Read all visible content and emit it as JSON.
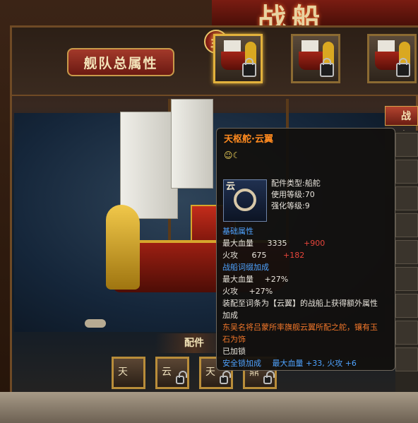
{
  "header": {
    "banner_title": "战船"
  },
  "fleet": {
    "attributes_button": "舰队总属性",
    "main_badge": "主",
    "ships": [
      {
        "state": "active"
      },
      {
        "state": "locked"
      },
      {
        "state": "locked"
      }
    ]
  },
  "right_panel": {
    "tab_label": "战船"
  },
  "parts": {
    "label": "配件",
    "slots": [
      {
        "glyph": "天"
      },
      {
        "glyph": "云"
      },
      {
        "glyph": "天"
      },
      {
        "glyph": "鼎"
      }
    ]
  },
  "tooltip": {
    "title": "天枢舵·云翼",
    "emotes": "☺☾",
    "icon_glyph": "云",
    "part_type_label": "配件类型:",
    "part_type_value": "船舵",
    "use_level_label": "使用等级:",
    "use_level_value": "70",
    "enhance_level_label": "强化等级:",
    "enhance_level_value": "9",
    "base_attr_title": "基础属性",
    "base_attrs": [
      {
        "name": "最大血量",
        "value": "3335",
        "bonus": "+900"
      },
      {
        "name": "火攻",
        "value": "675",
        "bonus": "+182"
      }
    ],
    "affix_title": "战船词缀加成",
    "affixes": [
      {
        "name": "最大血量",
        "value": "+27%"
      },
      {
        "name": "火攻",
        "value": "+27%"
      }
    ],
    "desc_line1": "装配至词条为【云翼】的战船上获得额外属性",
    "desc_line2": "加成",
    "lore_line1": "东吴名将吕蒙所率旗舰云翼所配之舵，镶有玉",
    "lore_line2": "石为饰",
    "lock_status": "已加锁",
    "safety_lock_label": "安全锁加成",
    "safety_lock_value": "最大血量 +33, 火攻 +6"
  },
  "colors": {
    "title_orange": "#ff8a1f",
    "section_blue": "#4fa3ff",
    "bonus_red": "#e8453b",
    "lore_orange": "#f0762a",
    "slot_gold": "#e2b13c"
  }
}
